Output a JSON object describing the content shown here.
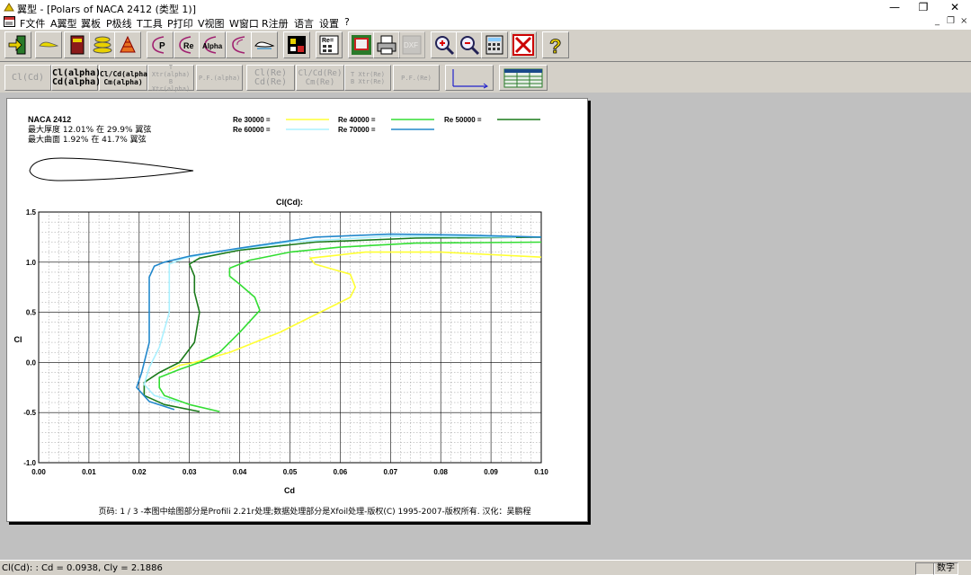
{
  "window": {
    "title": "翼型 - [Polars of NACA 2412 (类型 1)]",
    "minimize": "—",
    "maximize": "❐",
    "close": "✕"
  },
  "menu": {
    "items": [
      "F文件",
      "A翼型",
      "翼板",
      "P极线",
      "T工具",
      "P打印",
      "V视图",
      "W窗口",
      "R注册",
      "语言",
      "设置",
      "?"
    ],
    "mdi_min": "_",
    "mdi_restore": "❐",
    "mdi_close": "×"
  },
  "toolbar2": {
    "cl_cd": "Cl(Cd)",
    "cl_alpha": "Cl(alpha)",
    "cd_alpha": "Cd(alpha)",
    "clcd_alpha": "Cl/Cd(alpha)",
    "cm_alpha": "Cm(alpha)",
    "t_xtr_alpha": "T Xtr(alpha)",
    "b_xtr_alpha": "B Xtr(alpha)",
    "pf_alpha": "P.F.(alpha)",
    "cl_re": "Cl(Re)",
    "cd_re": "Cd(Re)",
    "clcd_re": "Cl/Cd(Re)",
    "cm_re": "Cm(Re)",
    "t_xtr_re": "T Xtr(Re)",
    "b_xtr_re": "B Xtr(Re)",
    "pf_re": "P.F.(Re)"
  },
  "airfoil": {
    "name": "NACA 2412",
    "thickness": "最大厚度 12.01% 在 29.9% 翼弦",
    "camber": "最大曲面 1.92% 在 41.7% 翼弦"
  },
  "legend": [
    {
      "label": "Re 30000 =",
      "color": "#ffff33"
    },
    {
      "label": "Re 40000 =",
      "color": "#33dd33"
    },
    {
      "label": "Re 50000 =",
      "color": "#1a7a1a"
    },
    {
      "label": "Re 60000 =",
      "color": "#aaf0ff"
    },
    {
      "label": "Re 70000 =",
      "color": "#2288cc"
    }
  ],
  "footer": "页码: 1 / 3 -本图中绘图部分是Profili 2.21r处理;数据处理部分是Xfoil处理-版权(C) 1995-2007-版权所有. 汉化：吴鹏程",
  "status": {
    "text": "Cl(Cd): : Cd = 0.0938, Cly = 2.1886",
    "num": "数字"
  },
  "chart_data": {
    "type": "line",
    "title": "Cl(Cd):",
    "xlabel": "Cd",
    "ylabel": "Cl",
    "xlim": [
      0.0,
      0.1
    ],
    "ylim": [
      -1.0,
      1.5
    ],
    "x_ticks": [
      "0.00",
      "0.01",
      "0.02",
      "0.03",
      "0.04",
      "0.05",
      "0.06",
      "0.07",
      "0.08",
      "0.09",
      "0.10"
    ],
    "y_ticks": [
      "-1.0",
      "-0.5",
      "0.0",
      "0.5",
      "1.0",
      "1.5"
    ],
    "grid": true,
    "series": [
      {
        "name": "Re 30000 =",
        "color": "#ffff33",
        "points": [
          [
            0.026,
            -0.08
          ],
          [
            0.028,
            -0.03
          ],
          [
            0.031,
            0.0
          ],
          [
            0.038,
            0.1
          ],
          [
            0.048,
            0.3
          ],
          [
            0.062,
            0.65
          ],
          [
            0.063,
            0.75
          ],
          [
            0.062,
            0.88
          ],
          [
            0.055,
            0.98
          ],
          [
            0.054,
            1.04
          ],
          [
            0.065,
            1.1
          ],
          [
            0.08,
            1.1
          ],
          [
            0.1,
            1.05
          ]
        ]
      },
      {
        "name": "Re 40000 =",
        "color": "#33dd33",
        "points": [
          [
            0.036,
            -0.49
          ],
          [
            0.03,
            -0.42
          ],
          [
            0.025,
            -0.33
          ],
          [
            0.024,
            -0.25
          ],
          [
            0.024,
            -0.15
          ],
          [
            0.028,
            -0.07
          ],
          [
            0.032,
            0.0
          ],
          [
            0.036,
            0.1
          ],
          [
            0.04,
            0.3
          ],
          [
            0.044,
            0.52
          ],
          [
            0.043,
            0.65
          ],
          [
            0.04,
            0.78
          ],
          [
            0.038,
            0.86
          ],
          [
            0.038,
            0.94
          ],
          [
            0.042,
            1.02
          ],
          [
            0.05,
            1.1
          ],
          [
            0.06,
            1.15
          ],
          [
            0.075,
            1.19
          ],
          [
            0.1,
            1.2
          ]
        ]
      },
      {
        "name": "Re 50000 =",
        "color": "#1a7a1a",
        "points": [
          [
            0.032,
            -0.49
          ],
          [
            0.025,
            -0.42
          ],
          [
            0.021,
            -0.33
          ],
          [
            0.021,
            -0.2
          ],
          [
            0.024,
            -0.1
          ],
          [
            0.028,
            0.0
          ],
          [
            0.031,
            0.2
          ],
          [
            0.032,
            0.5
          ],
          [
            0.031,
            0.7
          ],
          [
            0.031,
            0.86
          ],
          [
            0.03,
            0.98
          ],
          [
            0.032,
            1.04
          ],
          [
            0.04,
            1.12
          ],
          [
            0.055,
            1.2
          ],
          [
            0.075,
            1.24
          ],
          [
            0.1,
            1.25
          ]
        ]
      },
      {
        "name": "Re 60000 =",
        "color": "#aaf0ff",
        "points": [
          [
            0.028,
            -0.4
          ],
          [
            0.023,
            -0.33
          ],
          [
            0.021,
            -0.22
          ],
          [
            0.022,
            -0.05
          ],
          [
            0.024,
            0.15
          ],
          [
            0.026,
            0.5
          ],
          [
            0.026,
            0.82
          ],
          [
            0.026,
            0.98
          ],
          [
            0.029,
            1.04
          ],
          [
            0.035,
            1.1
          ],
          [
            0.05,
            1.2
          ],
          [
            0.07,
            1.26
          ],
          [
            0.095,
            1.25
          ]
        ]
      },
      {
        "name": "Re 70000 =",
        "color": "#2288cc",
        "points": [
          [
            0.027,
            -0.47
          ],
          [
            0.022,
            -0.39
          ],
          [
            0.0195,
            -0.25
          ],
          [
            0.0205,
            -0.1
          ],
          [
            0.022,
            0.2
          ],
          [
            0.022,
            0.6
          ],
          [
            0.022,
            0.85
          ],
          [
            0.023,
            0.96
          ],
          [
            0.025,
            1.0
          ],
          [
            0.03,
            1.06
          ],
          [
            0.04,
            1.14
          ],
          [
            0.055,
            1.25
          ],
          [
            0.07,
            1.28
          ],
          [
            0.085,
            1.27
          ],
          [
            0.1,
            1.25
          ]
        ]
      }
    ]
  }
}
